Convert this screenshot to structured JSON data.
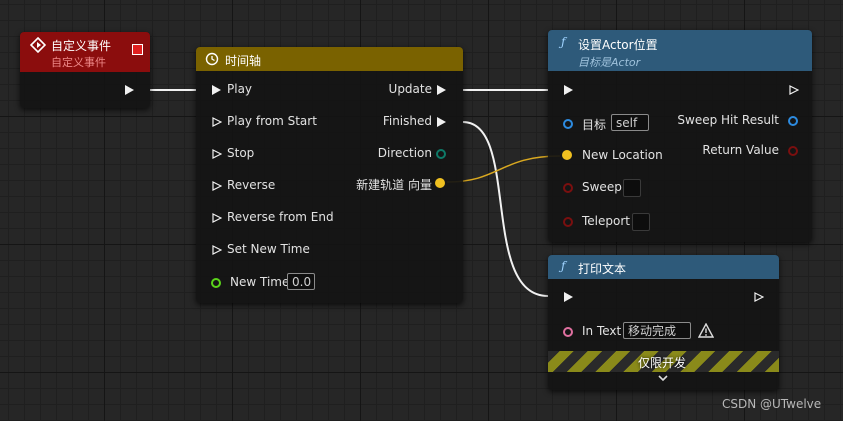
{
  "event_node": {
    "title": "自定义事件",
    "subtitle": "自定义事件",
    "color": "#8b0d0d"
  },
  "timeline_node": {
    "title": "时间轴",
    "color": "#7a6200",
    "inputs": [
      "Play",
      "Play from Start",
      "Stop",
      "Reverse",
      "Reverse from End",
      "Set New Time",
      "New Time"
    ],
    "new_time_value": "0.0",
    "outputs": [
      "Update",
      "Finished",
      "Direction",
      "新建轨道 向量"
    ]
  },
  "set_location_node": {
    "title": "设置Actor位置",
    "subtitle": "目标是Actor",
    "color": "#2e5a7a",
    "inputs": [
      "目标",
      "New Location",
      "Sweep",
      "Teleport"
    ],
    "target_value": "self",
    "outputs": [
      "Sweep Hit Result",
      "Return Value"
    ]
  },
  "print_node": {
    "title": "打印文本",
    "color": "#2e5a7a",
    "in_text_label": "In Text",
    "in_text_value": "移动完成",
    "dev_only_label": "仅限开发"
  },
  "watermark": "CSDN @UTwelve"
}
